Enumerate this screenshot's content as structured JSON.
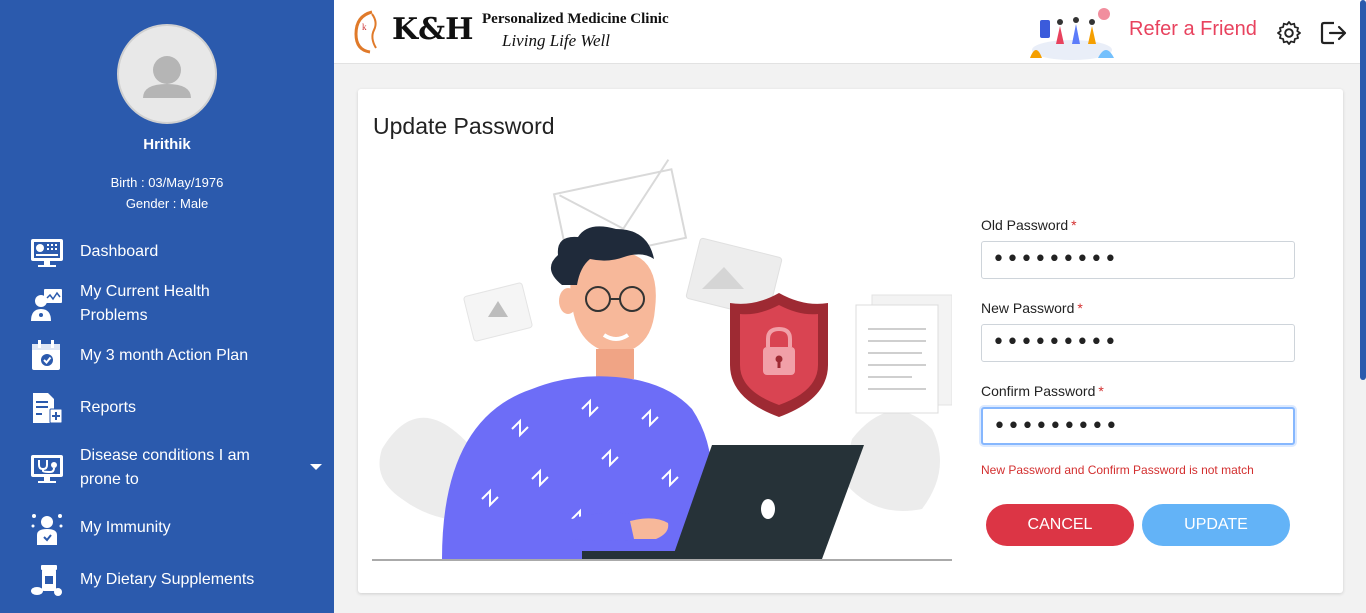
{
  "sidebar": {
    "user_name": "Hrithik",
    "birth": "Birth : 03/May/1976",
    "gender": "Gender : Male",
    "items": [
      {
        "label": "Dashboard",
        "icon": "dashboard-icon"
      },
      {
        "label": "My Current Health Problems",
        "icon": "doctor-icon"
      },
      {
        "label": "My 3 month Action Plan",
        "icon": "calendar-check-icon"
      },
      {
        "label": "Reports",
        "icon": "report-icon"
      },
      {
        "label": "Disease conditions I am prone to",
        "icon": "monitor-stethoscope-icon"
      },
      {
        "label": "My Immunity",
        "icon": "immunity-icon"
      },
      {
        "label": "My Dietary Supplements",
        "icon": "pills-icon"
      }
    ],
    "bg_color": "#2b5aad"
  },
  "header": {
    "logo_text": "K&H",
    "clinic_name": "Personalized Medicine Clinic",
    "tagline": "Living Life Well",
    "refer_label": "Refer a Friend",
    "accent_color": "#e8425e"
  },
  "form": {
    "title": "Update Password",
    "old_label": "Old Password",
    "new_label": "New Password",
    "confirm_label": "Confirm Password",
    "required_mark": "*",
    "old_value": "•••••••••",
    "new_value": "•••••••••",
    "confirm_value": "•••••••••",
    "error": "New Password and Confirm Password is not match",
    "cancel_label": "CANCEL",
    "update_label": "UPDATE",
    "cancel_color": "#dc3545",
    "update_color": "#63b3f7"
  }
}
